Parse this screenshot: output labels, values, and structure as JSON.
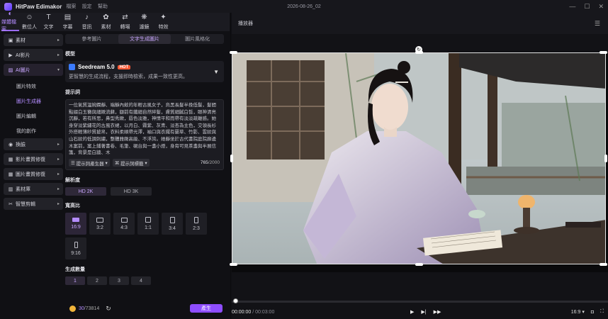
{
  "app": {
    "name": "HitPaw Edimakor",
    "menus": [
      "檔案",
      "設定",
      "幫助"
    ],
    "date": "2026-08-26_02"
  },
  "toolbar": [
    {
      "label": "媒體檔案",
      "icon": "media-icon",
      "glyph": "◐"
    },
    {
      "label": "數位人",
      "icon": "avatar-icon",
      "glyph": "☺"
    },
    {
      "label": "文字",
      "icon": "text-icon",
      "glyph": "T"
    },
    {
      "label": "字幕",
      "icon": "subtitle-icon",
      "glyph": "▤"
    },
    {
      "label": "音訊",
      "icon": "audio-icon",
      "glyph": "♪"
    },
    {
      "label": "素材",
      "icon": "sticker-icon",
      "glyph": "✿"
    },
    {
      "label": "轉場",
      "icon": "transition-icon",
      "glyph": "⇄"
    },
    {
      "label": "濾鏡",
      "icon": "filter-icon",
      "glyph": "❋"
    },
    {
      "label": "特效",
      "icon": "effects-icon",
      "glyph": "✦"
    }
  ],
  "sidebar": {
    "groups": [
      {
        "label": "素材",
        "glyph": "▣"
      },
      {
        "label": "AI影片",
        "glyph": "▶"
      },
      {
        "label": "AI圖片",
        "glyph": "▨",
        "active": true
      },
      {
        "label": "換臉",
        "glyph": "◉"
      },
      {
        "label": "影片畫質修復",
        "glyph": "▦"
      },
      {
        "label": "圖片畫質修復",
        "glyph": "▦"
      },
      {
        "label": "素材庫",
        "glyph": "▥"
      },
      {
        "label": "智慧剪輯",
        "glyph": "✂"
      }
    ],
    "subitems": [
      "圖片特效",
      "圖片生成器",
      "圖片編輯",
      "我的創作"
    ]
  },
  "panel": {
    "tabs": [
      "參考圖片",
      "文字生成圖片",
      "圖片風格化"
    ],
    "model_title": "模型",
    "model_name": "Seedream 5.0",
    "model_badge": "HOT",
    "model_desc": "更智慧的生成流程，支援即時檢索，成果一致性更高。",
    "prompt_title": "提示詞",
    "prompt_text": "一位氣質溫婉嫻靜、端靜內斂的年輕古風女子，烏黑長髮半挽低髻，髮間點綴白玉簪與細緻流蘇，額前有纖細自然碎髮，膚質細膩白皙，眼神清亮沉靜，若有所思，鼻型秀緻，唇色淡雅，神情平和而帶有淡淡疏離感。她身穿淡紫繡花的古風衣裙，以月白、霧紫、灰青、淡杏為主色，交領長衫外搭輕薄紗質披帛，衣料柔順帶光澤，袖口與衣擺有蘭草、竹影、雲紋與山石紋的低調刺繡，整體雅緻高級、不浮誇。她靜坐於古代書院庭院廊邊木案前，案上鋪著書卷、毛筆、硯台與一盞小燈，身旁可見茶盞與半展信箋，背景是白牆、木",
    "prompt_btn1": "提示詞產生器",
    "prompt_btn2": "提示詞標籤",
    "prompt_count": "765",
    "prompt_max": "/2000",
    "res_title": "解析度",
    "resolutions": [
      "HD 2K",
      "HD 3K"
    ],
    "ratio_title": "寬高比",
    "ratios": [
      "16:9",
      "3:2",
      "4:3",
      "1:1",
      "3:4",
      "2:3",
      "9:16"
    ],
    "count_title": "生成數量",
    "counts": [
      "1",
      "2",
      "3",
      "4"
    ],
    "credits_used": "30",
    "credits_total": "/73814",
    "generate": "產生"
  },
  "player": {
    "title": "播放器",
    "time_current": "00:00:00",
    "time_total": " / 00:03:00",
    "aspect": "16:9",
    "progress": 0
  }
}
